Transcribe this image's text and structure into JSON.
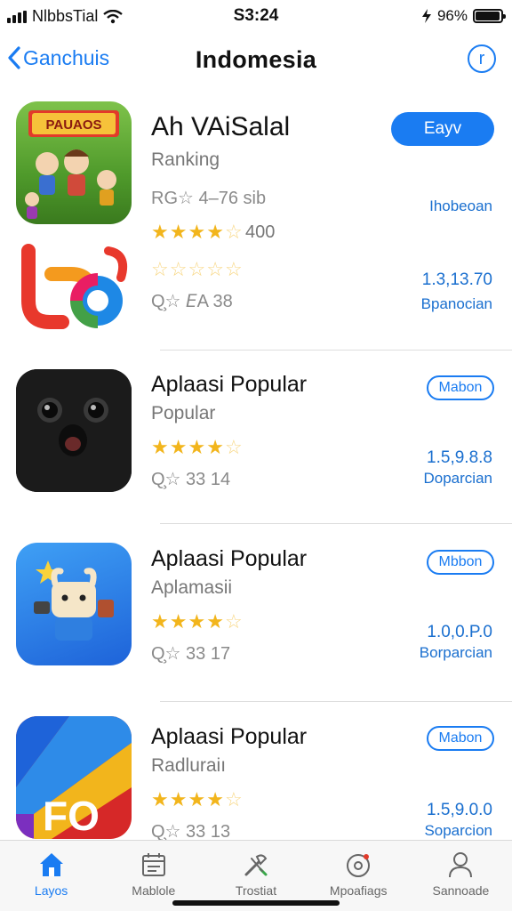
{
  "status": {
    "carrier": "NlbbsTial",
    "time": "S3:24",
    "battery_text": "96%",
    "battery_level": 0.96,
    "extra_icon": "bolt-icon"
  },
  "nav": {
    "back_label": "Ganchuis",
    "title": "Indomesia",
    "right_icon": "info-circle-icon"
  },
  "colors": {
    "accent": "#1a7cf2",
    "star": "#f2b51c"
  },
  "apps": [
    {
      "title": "Ah VAiSalal",
      "subtitle": "Ranking",
      "meta1": "RG☆ 4–76 sib",
      "stars": 4,
      "count": "400",
      "button": "Eayv",
      "right_sub": "Ihobeoan"
    },
    {
      "stars": 0,
      "meta": "Q̧☆ 𝘌A  38",
      "right_num": "1.3,13.70",
      "right_sub": "Bpanocian"
    },
    {
      "title": "Aplaasi Popular",
      "subtitle": "Popular",
      "stars": 4,
      "meta": "Q̧☆  33   14",
      "button": "Mabon",
      "right_num": "1.5,9.8.8",
      "right_sub": "Doparcian"
    },
    {
      "title": "Aplaasi Popular",
      "subtitle": "Aplamasii",
      "stars": 4,
      "meta": "Q̧☆  33   17",
      "button": "Mbbon",
      "right_num": "1.0,0.P.0",
      "right_sub": "Borparcian"
    },
    {
      "title": "Aplaasi Popular",
      "subtitle": "Radluraiı",
      "stars": 4,
      "meta": "Q̧☆  33   13",
      "button": "Mabon",
      "right_num": "1.5,9.0.0",
      "right_sub": "Soparcion"
    }
  ],
  "tabs": [
    {
      "label": "Layos",
      "icon": "home-icon",
      "active": true
    },
    {
      "label": "Mablole",
      "icon": "calendar-icon",
      "active": false
    },
    {
      "label": "Trostiat",
      "icon": "tools-icon",
      "active": false
    },
    {
      "label": "Mpoafiags",
      "icon": "clock-icon",
      "active": false
    },
    {
      "label": "Sannoade",
      "icon": "person-icon",
      "active": false
    }
  ]
}
